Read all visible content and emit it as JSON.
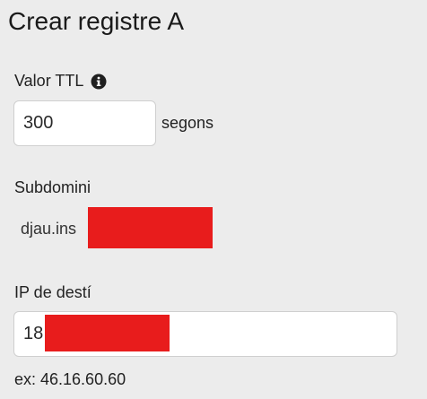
{
  "page": {
    "title": "Crear registre A"
  },
  "ttl": {
    "label": "Valor TTL",
    "info_icon": "info-circle-icon",
    "value": "300",
    "unit": "segons"
  },
  "subdomain": {
    "label": "Subdomini",
    "value": "djau.ins"
  },
  "ip": {
    "label": "IP de destí",
    "value": "18",
    "hint": "ex: 46.16.60.60"
  },
  "colors": {
    "background": "#ececec",
    "redaction": "#e81c1c"
  }
}
